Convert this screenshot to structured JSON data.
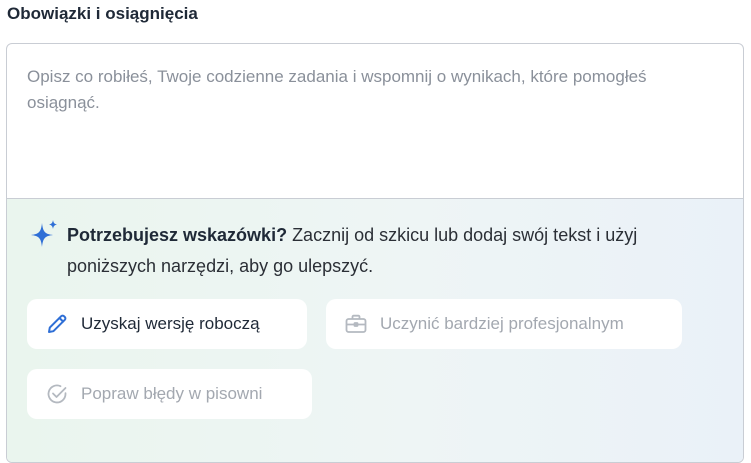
{
  "field": {
    "label": "Obowiązki i osiągnięcia",
    "placeholder": "Opisz co robiłeś, Twoje codzienne zadania i wspomnij o wynikach, które pomogłeś osiągnąć.",
    "value": ""
  },
  "assist": {
    "icon": "sparkle-icon",
    "hint_bold": "Potrzebujesz wskazówki?",
    "hint_text": " Zacznij od szkicu lub dodaj swój tekst i użyj poniższych narzędzi, aby go ulepszyć.",
    "actions": [
      {
        "label": "Uzyskaj wersję roboczą",
        "icon": "pencil-icon",
        "enabled": true
      },
      {
        "label": "Uczynić bardziej profesjonalnym",
        "icon": "briefcase-icon",
        "enabled": false
      },
      {
        "label": "Popraw błędy w pisowni",
        "icon": "check-circle-icon",
        "enabled": false
      }
    ]
  },
  "colors": {
    "accent": "#2f6fd6",
    "sparkle": "#2f6fd6",
    "text": "#1f2937",
    "disabled_text": "#a3a8b0",
    "placeholder": "#8a909a",
    "border": "#c9cdd4",
    "panel_gradient_start": "#eaf5ee",
    "panel_gradient_end": "#eaf1f8"
  }
}
